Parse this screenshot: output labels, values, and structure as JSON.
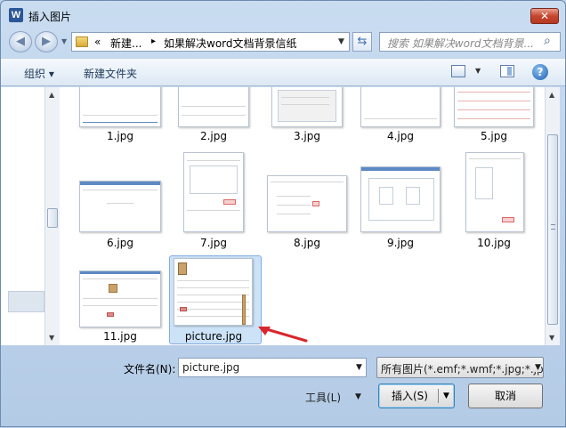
{
  "window": {
    "title": "插入图片",
    "app_icon": "W",
    "close_label": "✕"
  },
  "nav": {
    "breadcrumb_root": "«",
    "breadcrumb_1": "新建...",
    "breadcrumb_sep": "▸",
    "breadcrumb_2": "如果解决word文档背景信纸",
    "search_placeholder": "搜索 如果解决word文档背景...",
    "back_icon": "back-arrow-icon",
    "forward_icon": "forward-arrow-icon"
  },
  "toolbar": {
    "organize_label": "组织 ▾",
    "new_folder_label": "新建文件夹",
    "help_label": "?"
  },
  "files": [
    {
      "name": "1.jpg"
    },
    {
      "name": "2.jpg"
    },
    {
      "name": "3.jpg"
    },
    {
      "name": "4.jpg"
    },
    {
      "name": "5.jpg"
    },
    {
      "name": "6.jpg"
    },
    {
      "name": "7.jpg"
    },
    {
      "name": "8.jpg"
    },
    {
      "name": "9.jpg"
    },
    {
      "name": "10.jpg"
    },
    {
      "name": "11.jpg"
    },
    {
      "name": "picture.jpg",
      "selected": true
    }
  ],
  "bottom": {
    "filename_label": "文件名(N):",
    "filename_value": "picture.jpg",
    "filter_value": "所有图片(*.emf;*.wmf;*.jpg;*.jp",
    "tools_label": "工具(L)",
    "insert_label": "插入(S)",
    "cancel_label": "取消"
  },
  "colors": {
    "accent": "#3c7fb1",
    "selection": "#cce3f7",
    "annotation_arrow": "#d9262c"
  }
}
